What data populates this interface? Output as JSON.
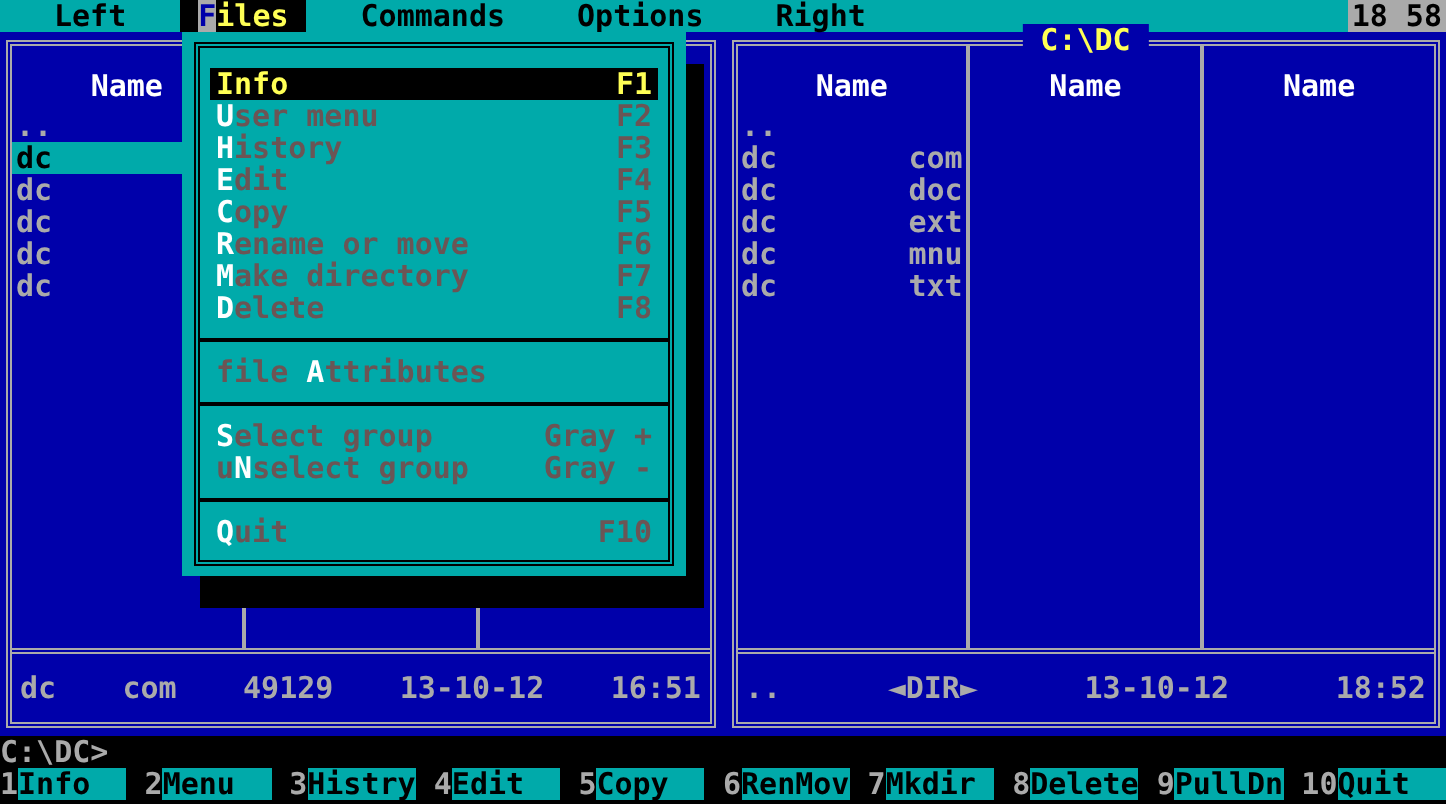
{
  "menu_bar": {
    "items": [
      {
        "label": "Left",
        "selected": false
      },
      {
        "label": "**F**iles",
        "selected": true
      },
      {
        "label": "Commands",
        "selected": false
      },
      {
        "label": "Options",
        "selected": false
      },
      {
        "label": "Right",
        "selected": false
      }
    ],
    "clock": "18 58"
  },
  "panels": [
    {
      "columns": [
        {
          "heading": "Name",
          "files": [
            {
              "name": "..",
              "selected": false
            },
            {
              "name": "dc",
              "selected": true
            },
            {
              "name": "dc",
              "selected": false
            },
            {
              "name": "dc",
              "selected": false
            },
            {
              "name": "dc",
              "selected": false
            },
            {
              "name": "dc",
              "selected": false
            }
          ]
        }
      ],
      "status": [
        "dc",
        "com",
        "49129",
        "13-10-12",
        "16:51"
      ]
    },
    {
      "title": "C:\\DC",
      "columns": [
        {
          "heading": "Name",
          "files": [
            {
              "name": "..",
              "selected": false
            },
            {
              "name": "dc",
              "ext": "com",
              "selected": false
            },
            {
              "name": "dc",
              "ext": "doc",
              "selected": false
            },
            {
              "name": "dc",
              "ext": "ext",
              "selected": false
            },
            {
              "name": "dc",
              "ext": "mnu",
              "selected": false
            },
            {
              "name": "dc",
              "ext": "txt",
              "selected": false
            }
          ]
        },
        {
          "heading": "Name"
        },
        {
          "heading": "Name"
        }
      ],
      "status": [
        "..",
        "◄DIR►",
        "13-10-12",
        "18:52"
      ]
    }
  ],
  "files_menu": {
    "items": [
      {
        "kind": "item",
        "label": "**I**nfo",
        "key": "F1",
        "selected": true
      },
      {
        "kind": "item",
        "label": "**U**ser menu",
        "key": "F2",
        "selected": false
      },
      {
        "kind": "item",
        "label": "**H**istory",
        "key": "F3",
        "selected": false
      },
      {
        "kind": "item",
        "label": "**E**dit",
        "key": "F4",
        "selected": false
      },
      {
        "kind": "item",
        "label": "**C**opy",
        "key": "F5",
        "selected": false
      },
      {
        "kind": "item",
        "label": "**R**ename or move",
        "key": "F6",
        "selected": false
      },
      {
        "kind": "item",
        "label": "**M**ake directory",
        "key": "F7",
        "selected": false
      },
      {
        "kind": "item",
        "label": "**D**elete",
        "key": "F8",
        "selected": false
      },
      {
        "kind": "separator"
      },
      {
        "kind": "item",
        "label": "file **A**ttributes",
        "selected": false
      },
      {
        "kind": "separator"
      },
      {
        "kind": "item",
        "label": "**S**elect group",
        "key": "Gray +",
        "selected": false
      },
      {
        "kind": "item",
        "label": "u**N**select group",
        "key": "Gray -",
        "selected": false
      },
      {
        "kind": "separator"
      },
      {
        "kind": "item",
        "label": "**Q**uit",
        "key": "F10",
        "selected": false
      }
    ]
  },
  "command_line": "C:\\DC>",
  "function_keys": [
    {
      "number": "1",
      "label": "Info"
    },
    {
      "number": "2",
      "label": "Menu"
    },
    {
      "number": "3",
      "label": "Histry"
    },
    {
      "number": "4",
      "label": "Edit"
    },
    {
      "number": "5",
      "label": "Copy"
    },
    {
      "number": "6",
      "label": "RenMov"
    },
    {
      "number": "7",
      "label": "Mkdir"
    },
    {
      "number": "8",
      "label": "Delete"
    },
    {
      "number": "9",
      "label": "PullDn"
    },
    {
      "number": "10",
      "label": "Quit"
    }
  ]
}
